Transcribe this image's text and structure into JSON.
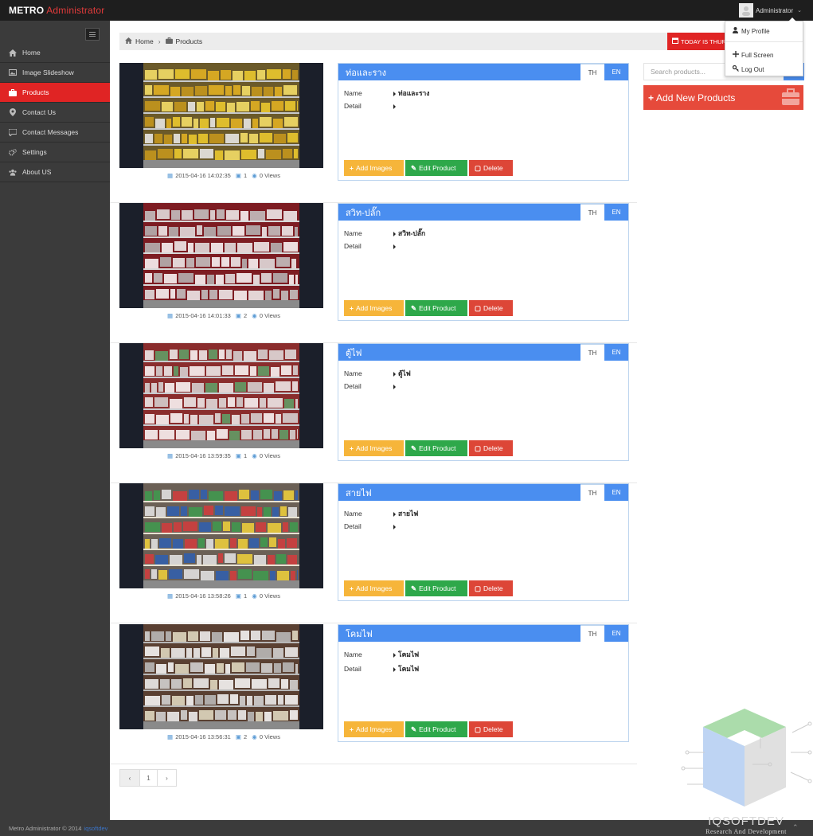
{
  "header": {
    "brand_main": "METRO",
    "brand_sub": "Administrator",
    "user_name": "Administrator"
  },
  "user_dropdown": {
    "items": [
      "My Profile",
      "Full Screen",
      "Log Out"
    ]
  },
  "sidebar": {
    "items": [
      {
        "label": "Home",
        "icon": "home-icon"
      },
      {
        "label": "Image Slideshow",
        "icon": "image-icon"
      },
      {
        "label": "Products",
        "icon": "briefcase-icon",
        "active": true
      },
      {
        "label": "Contact Us",
        "icon": "map-marker-icon"
      },
      {
        "label": "Contact Messages",
        "icon": "comment-icon"
      },
      {
        "label": "Settings",
        "icon": "gears-icon"
      },
      {
        "label": "About US",
        "icon": "users-icon"
      }
    ]
  },
  "breadcrumb": {
    "home": "Home",
    "current": "Products"
  },
  "today_label": "TODAY IS THURS",
  "search": {
    "placeholder": "Search products..."
  },
  "add_new_label": "Add New Products",
  "labels": {
    "name": "Name",
    "detail": "Detail",
    "tab_th": "TH",
    "tab_en": "EN",
    "add_images": "Add Images",
    "edit_product": "Edit Product",
    "delete": "Delete"
  },
  "products": [
    {
      "title": "ท่อและราง",
      "name": "ท่อและราง",
      "detail": "",
      "date": "2015-04-16 14:02:35",
      "images": "1",
      "views": "0 Views",
      "theme": "pipes"
    },
    {
      "title": "สวิท-ปลั๊ก",
      "name": "สวิท-ปลั๊ก",
      "detail": "",
      "date": "2015-04-16 14:01:33",
      "images": "2",
      "views": "0 Views",
      "theme": "switches"
    },
    {
      "title": "ตู้ไฟ",
      "name": "ตู้ไฟ",
      "detail": "",
      "date": "2015-04-16 13:59:35",
      "images": "1",
      "views": "0 Views",
      "theme": "cabinets"
    },
    {
      "title": "สายไฟ",
      "name": "สายไฟ",
      "detail": "",
      "date": "2015-04-16 13:58:26",
      "images": "1",
      "views": "0 Views",
      "theme": "wires"
    },
    {
      "title": "โคมไฟ",
      "name": "โคมไฟ",
      "detail": "โคมไฟ",
      "date": "2015-04-16 13:56:31",
      "images": "2",
      "views": "0 Views",
      "theme": "lamps"
    }
  ],
  "pagination": {
    "prev": "‹",
    "page": "1",
    "next": "›"
  },
  "footer": {
    "text": "Metro Administrator © 2014",
    "link": "iqsoftdev"
  },
  "watermark": {
    "line1": "IQSOFTDEV",
    "line2": "Research And Development"
  },
  "colors": {
    "accent_red": "#e02424",
    "header_blue": "#4a8ef0",
    "btn_add": "#f6b53a",
    "btn_edit": "#2ea84a",
    "btn_delete": "#dd4637"
  }
}
